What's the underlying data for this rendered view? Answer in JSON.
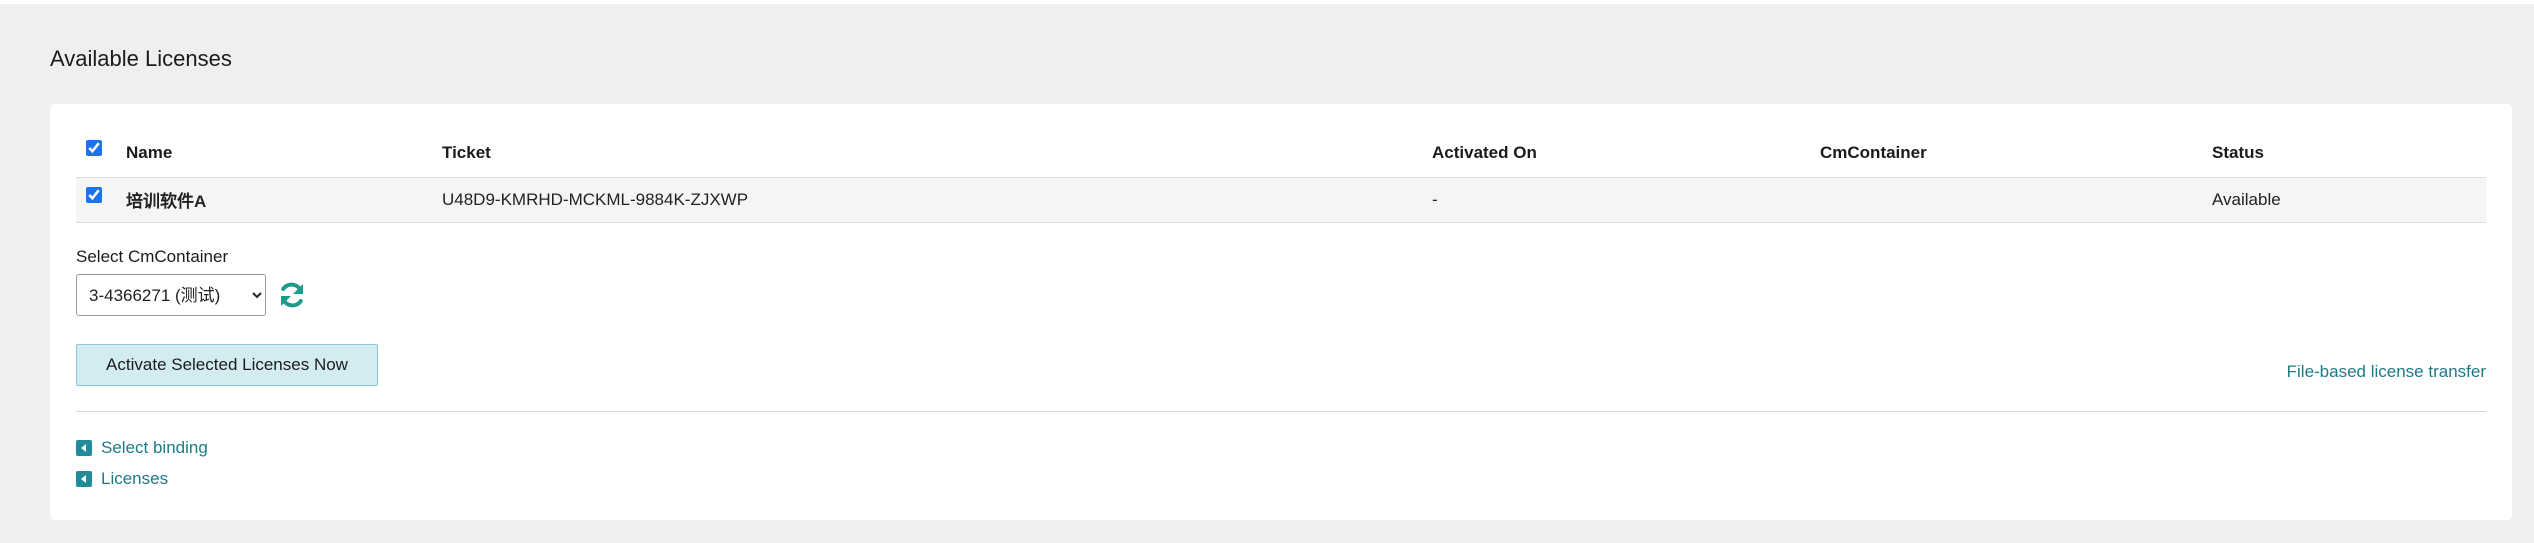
{
  "page": {
    "title": "Available Licenses"
  },
  "table": {
    "headers": {
      "name": "Name",
      "ticket": "Ticket",
      "activated_on": "Activated On",
      "cmcontainer": "CmContainer",
      "status": "Status"
    },
    "rows": [
      {
        "checked": true,
        "name": "培训软件A",
        "ticket": "U48D9-KMRHD-MCKML-9884K-ZJXWP",
        "activated_on": "-",
        "cmcontainer": "",
        "status": "Available"
      }
    ]
  },
  "cmcontainer_select": {
    "label": "Select CmContainer",
    "selected": "3-4366271 (测试)"
  },
  "actions": {
    "activate_label": "Activate Selected Licenses Now",
    "file_transfer_label": "File-based license transfer"
  },
  "nav": {
    "select_binding": "Select binding",
    "licenses": "Licenses"
  },
  "colors": {
    "accent": "#1e8c99",
    "link": "#1d7a86",
    "button_bg": "#d3ecf2"
  },
  "icons": {
    "refresh": "refresh-icon",
    "back_arrow": "caret-left-icon"
  }
}
